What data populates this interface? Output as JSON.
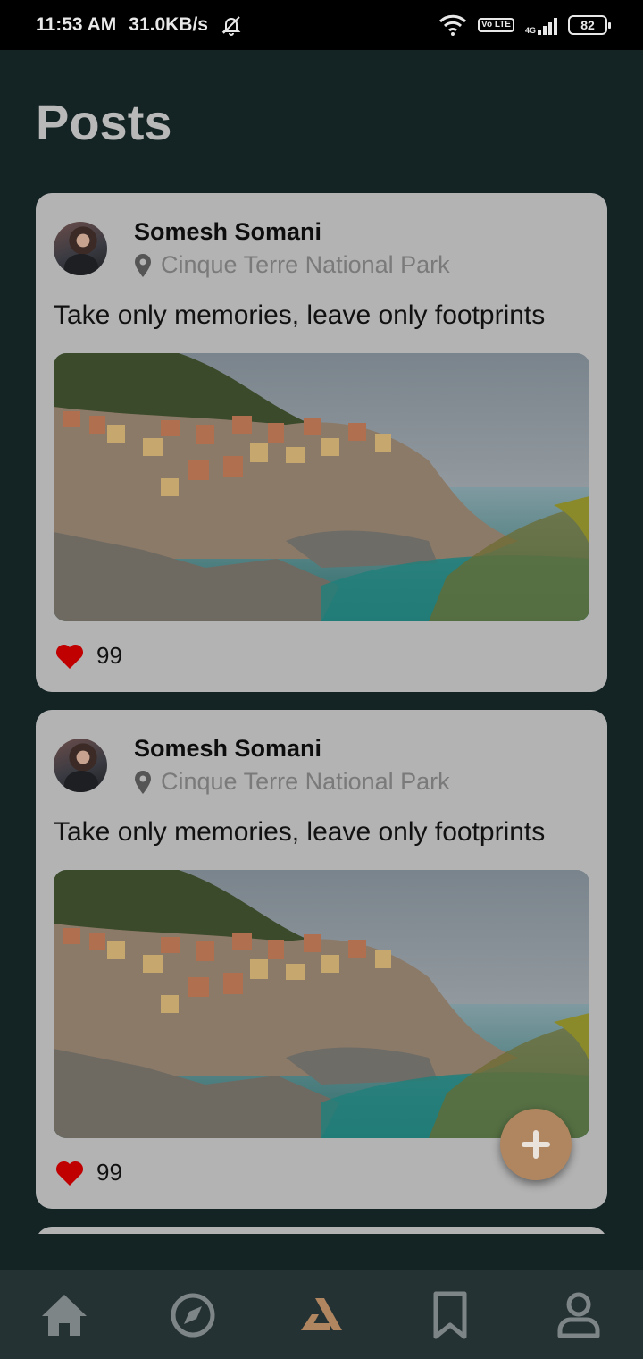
{
  "status_bar": {
    "time": "11:53 AM",
    "speed": "31.0KB/s",
    "network": "4G",
    "volte": "Vo LTE",
    "battery": "82",
    "icons": [
      "mute-bell-icon",
      "wifi-icon",
      "volte-icon",
      "signal-icon",
      "battery-icon"
    ]
  },
  "page": {
    "title": "Posts"
  },
  "posts": [
    {
      "author": "Somesh Somani",
      "location": "Cinque Terre National Park",
      "caption": "Take only memories, leave only footprints",
      "likes": "99"
    },
    {
      "author": "Somesh Somani",
      "location": "Cinque Terre National Park",
      "caption": "Take only memories, leave only footprints",
      "likes": "99"
    }
  ],
  "fab": {
    "icon": "plus-icon"
  },
  "nav": {
    "items": [
      {
        "icon": "home-icon",
        "active": false
      },
      {
        "icon": "compass-icon",
        "active": false
      },
      {
        "icon": "app-logo-icon",
        "active": true
      },
      {
        "icon": "bookmark-icon",
        "active": false
      },
      {
        "icon": "profile-icon",
        "active": false
      }
    ]
  },
  "colors": {
    "background": "#142324",
    "card": "#b3b3b3",
    "accent": "#b08660",
    "heart": "#c00000",
    "nav_icon": "#7d8587"
  }
}
